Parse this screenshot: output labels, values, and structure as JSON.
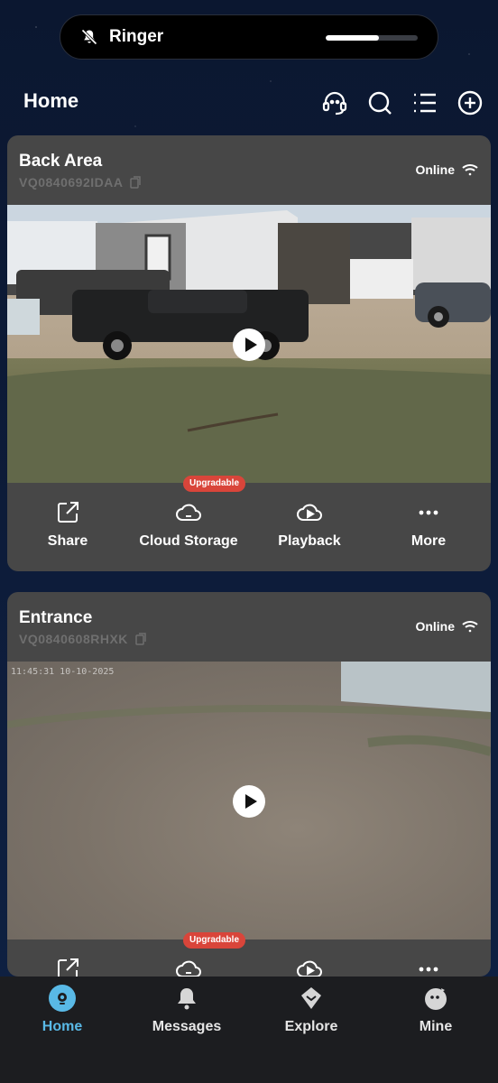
{
  "status_bar": {
    "ringer_label": "Ringer",
    "ringer_volume_fraction": 0.58
  },
  "header": {
    "title": "Home",
    "icons": [
      "support-headset-icon",
      "search-icon",
      "list-icon",
      "add-icon"
    ]
  },
  "devices": [
    {
      "name": "Back Area",
      "serial": "VQ0840692IDAA",
      "status": "Online",
      "timestamp": ""
    },
    {
      "name": "Entrance",
      "serial": "VQ0840608RHXK",
      "status": "Online",
      "timestamp": "11:45:31 10-10-2025"
    }
  ],
  "actions": {
    "share": "Share",
    "cloud_storage": "Cloud Storage",
    "cloud_badge": "Upgradable",
    "playback": "Playback",
    "more": "More"
  },
  "tabbar": {
    "home": "Home",
    "messages": "Messages",
    "explore": "Explore",
    "mine": "Mine",
    "active": "home",
    "accent_color": "#59b9e6"
  }
}
